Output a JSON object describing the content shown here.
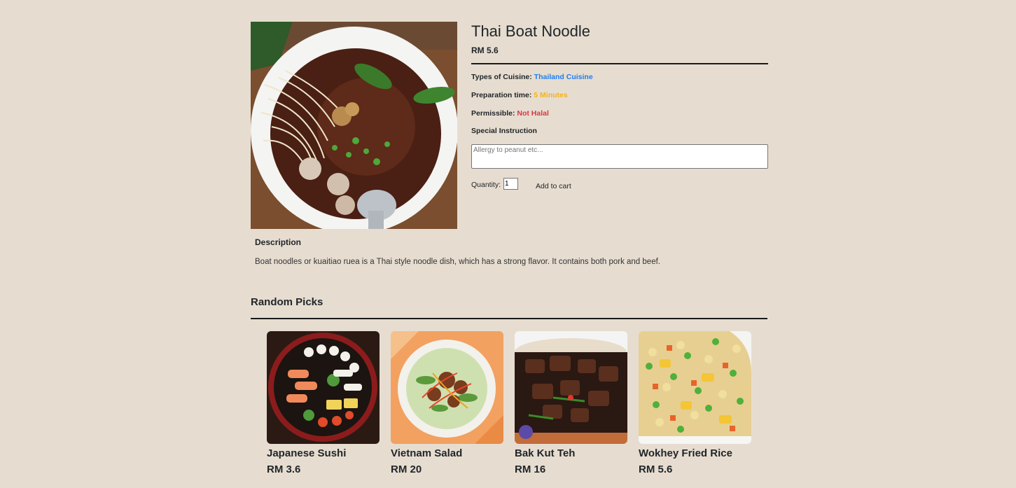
{
  "product": {
    "name": "Thai Boat Noodle",
    "price": "RM 5.6",
    "cuisine_label": "Types of Cuisine:",
    "cuisine_value": "Thailand Cuisine",
    "prep_label": "Preparation time:",
    "prep_value": "5 Minutes",
    "permissible_label": "Permissible:",
    "permissible_value": "Not Halal",
    "special_label": "Special Instruction",
    "special_placeholder": "Allergy to peanut etc...",
    "quantity_label": "Quantity:",
    "quantity_value": "1",
    "add_to_cart": "Add to cart",
    "description_title": "Description",
    "description_text": "Boat noodles or kuaitiao ruea is a Thai style noodle dish, which has a strong flavor. It contains both pork and beef."
  },
  "random_picks": {
    "title": "Random Picks",
    "items": [
      {
        "name": "Japanese Sushi",
        "price": "RM 3.6"
      },
      {
        "name": "Vietnam Salad",
        "price": "RM 20"
      },
      {
        "name": "Bak Kut Teh",
        "price": "RM 16"
      },
      {
        "name": "Wokhey Fried Rice",
        "price": "RM 5.6"
      }
    ]
  },
  "colors": {
    "background": "#e6ddd0",
    "cuisine": "#1e7ef0",
    "prep": "#f2b21b",
    "halal": "#dc3545"
  }
}
